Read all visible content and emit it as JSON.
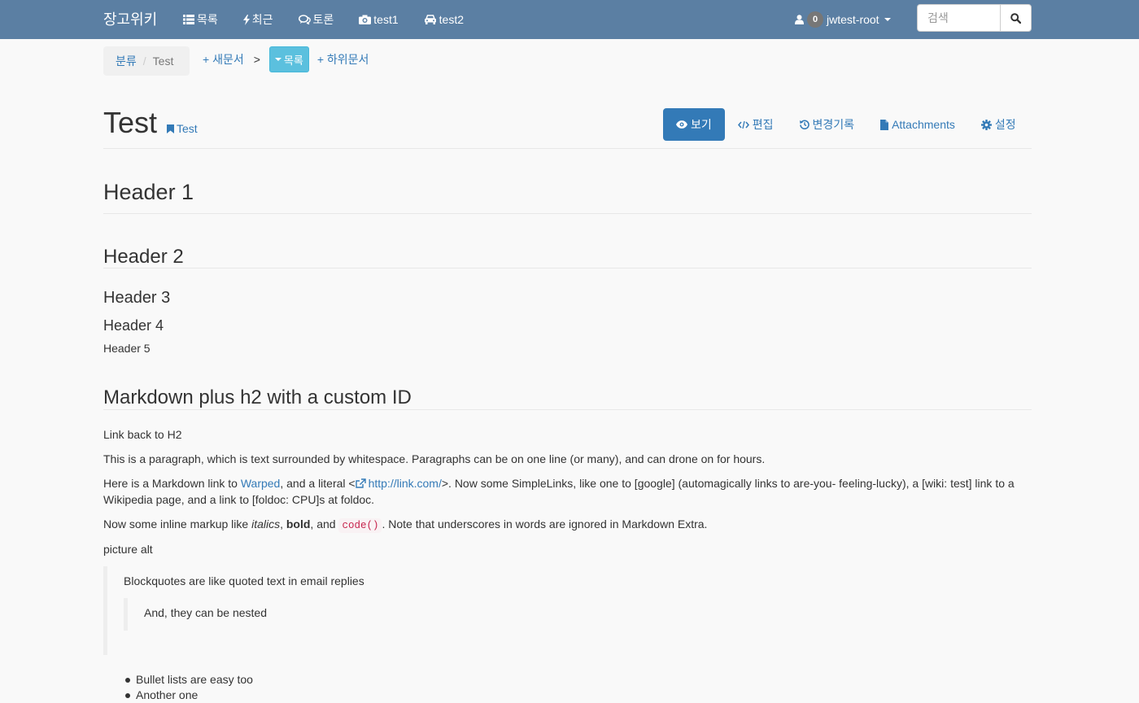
{
  "navbar": {
    "brand": "장고위키",
    "links": [
      {
        "label": "목록",
        "icon": "list-icon"
      },
      {
        "label": "최근",
        "icon": "bolt-icon"
      },
      {
        "label": "토론",
        "icon": "comments-icon"
      },
      {
        "label": "test1",
        "icon": "camera-icon"
      },
      {
        "label": "test2",
        "icon": "car-icon"
      }
    ],
    "user": {
      "badge": "0",
      "name": "jwtest-root"
    },
    "search": {
      "placeholder": "검색"
    }
  },
  "breadcrumb": {
    "root": "분류",
    "current": "Test",
    "new_doc": "+ 새문서",
    "gt": ">",
    "list_btn": "목록",
    "sub_doc": "+ 하위문서"
  },
  "page": {
    "title": "Test",
    "tag": "Test",
    "tabs": [
      {
        "label": "보기",
        "icon": "eye-icon",
        "active": true
      },
      {
        "label": "편집",
        "icon": "code-icon"
      },
      {
        "label": "변경기록",
        "icon": "history-icon"
      },
      {
        "label": "Attachments",
        "icon": "file-icon"
      },
      {
        "label": "설정",
        "icon": "gear-icon"
      }
    ]
  },
  "content": {
    "h1": "Header 1",
    "h2": "Header 2",
    "h3": "Header 3",
    "h4": "Header 4",
    "h5": "Header 5",
    "h2_custom": "Markdown plus h2 with a custom ID",
    "link_back": "Link back to H2",
    "p1": "This is a paragraph, which is text surrounded by whitespace. Paragraphs can be on one line (or many), and can drone on for hours.",
    "p2_pre": "Here is a Markdown link to ",
    "p2_link1": "Warped",
    "p2_mid": ", and a literal <",
    "p2_link2": "http://link.com/",
    "p2_post": ">. Now some SimpleLinks, like one to [google] (automagically links to are-you- feeling-lucky), a [wiki: test] link to a Wikipedia page, and a link to [foldoc: CPU]s at foldoc.",
    "p3_pre": "Now some inline markup like ",
    "p3_italic": "italics",
    "p3_comma": ", ",
    "p3_bold": "bold",
    "p3_and": ", and ",
    "p3_code": "code()",
    "p3_post": ". Note that underscores in words are ignored in Markdown Extra.",
    "picture_alt": "picture alt",
    "blockquote": "Blockquotes are like quoted text in email replies",
    "blockquote_nested": "And, they can be nested",
    "bullets": [
      "Bullet lists are easy too",
      "Another one"
    ]
  }
}
